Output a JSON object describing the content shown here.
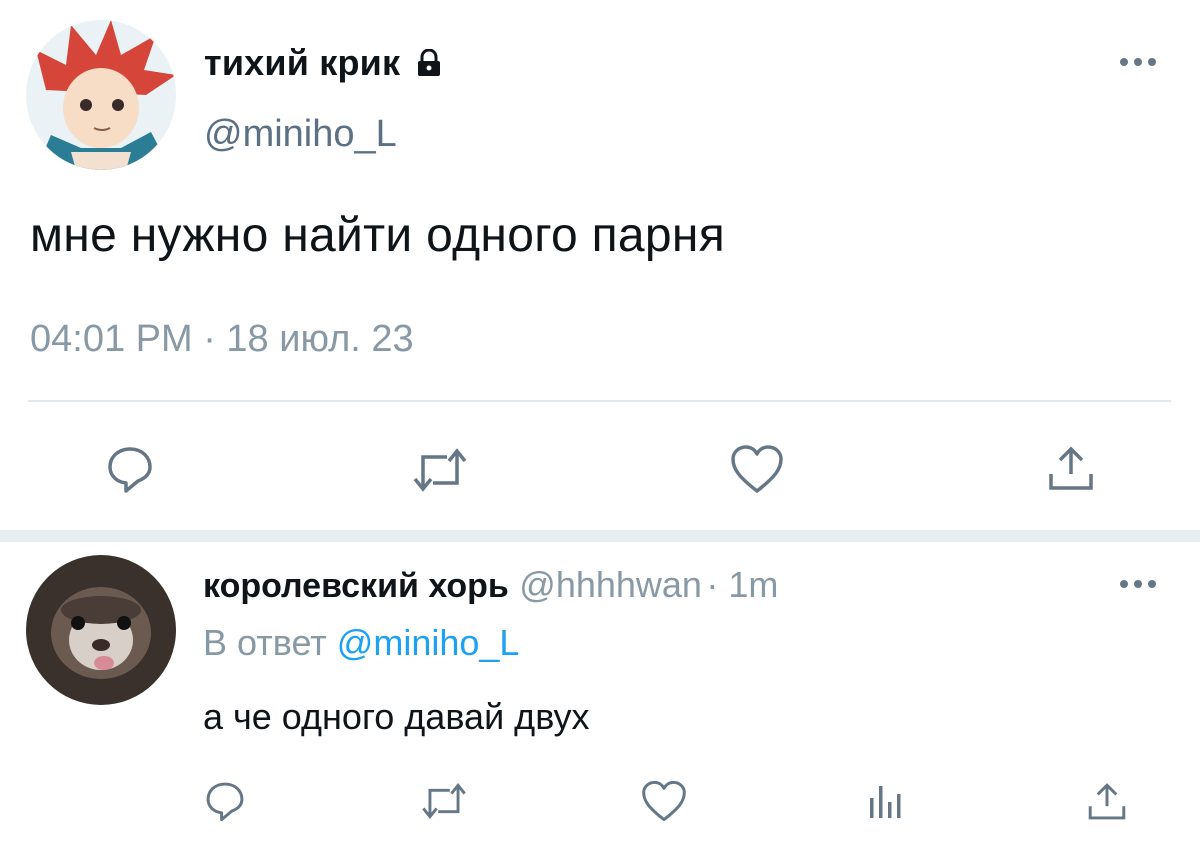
{
  "tweet": {
    "author_name": "тихий крик",
    "author_handle": "@miniho_L",
    "locked_icon": "lock-icon",
    "text": "мне нужно найти одного парня",
    "timestamp": "04:01 PM · 18 июл. 23",
    "more_icon": "more-dots-icon",
    "actions": [
      "reply-icon",
      "retweet-icon",
      "like-icon",
      "share-icon"
    ]
  },
  "reply": {
    "author_name": "королевский хорь",
    "author_handle": "@hhhhwan",
    "time": "· 1m",
    "in_reply_prefix": "В ответ",
    "in_reply_handle": "@miniho_L",
    "text": "а че одного давай двух",
    "more_icon": "more-dots-icon",
    "actions": [
      "reply-icon",
      "retweet-icon",
      "like-icon",
      "analytics-icon",
      "share-icon"
    ]
  },
  "colors": {
    "accent": "#1da1f2",
    "secondary_text": "#8899a6",
    "primary_text": "#0f1419",
    "divider": "#e1e8ed"
  }
}
